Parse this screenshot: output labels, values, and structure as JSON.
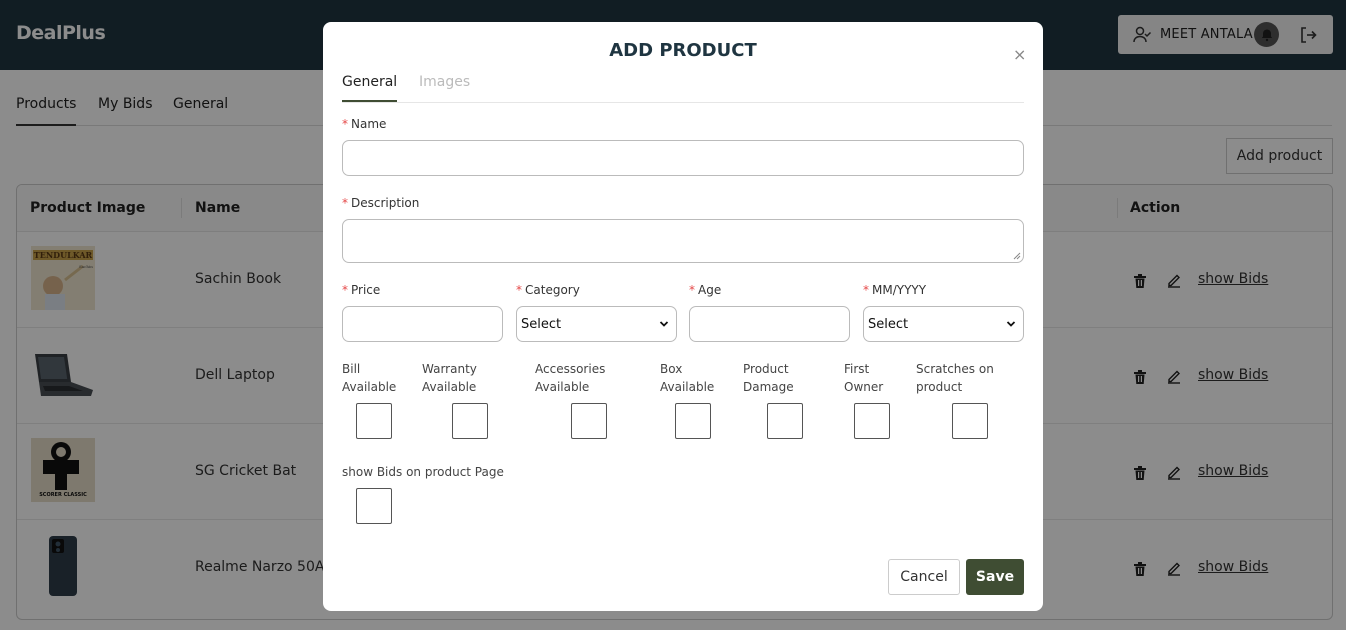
{
  "app": {
    "brand": "DealPlus"
  },
  "user": {
    "name": "MEET ANTALA"
  },
  "tabs": [
    {
      "label": "Products",
      "active": true
    },
    {
      "label": "My Bids",
      "active": false
    },
    {
      "label": "General",
      "active": false
    }
  ],
  "toolbar": {
    "add_product_label": "Add product"
  },
  "table": {
    "headers": [
      "Product Image",
      "Name",
      "Action"
    ],
    "rows": [
      {
        "name": "Sachin Book",
        "bids_label": "show Bids"
      },
      {
        "name": "Dell Laptop",
        "bids_label": "show Bids"
      },
      {
        "name": "SG Cricket Bat",
        "bids_label": "show Bids"
      },
      {
        "name": "Realme Narzo 50A",
        "bids_label": "show Bids"
      }
    ]
  },
  "modal": {
    "title": "ADD PRODUCT",
    "close": "×",
    "tabs": [
      {
        "label": "General",
        "active": true
      },
      {
        "label": "Images",
        "active": false
      }
    ],
    "fields": {
      "required_mark": "*",
      "name": {
        "label": "Name",
        "value": ""
      },
      "description": {
        "label": "Description",
        "value": ""
      },
      "price": {
        "label": "Price",
        "value": ""
      },
      "category": {
        "label": "Category",
        "selected": "Select"
      },
      "age": {
        "label": "Age",
        "value": ""
      },
      "month_year": {
        "label": "MM/YYYY",
        "selected": "Select"
      }
    },
    "checkboxes": [
      {
        "label_line1": "Bill",
        "label_line2": "Available",
        "checked": false
      },
      {
        "label_line1": "Warranty",
        "label_line2": "Available",
        "checked": false
      },
      {
        "label_line1": "Accessories",
        "label_line2": "Available",
        "checked": false
      },
      {
        "label_line1": "Box",
        "label_line2": "Available",
        "checked": false
      },
      {
        "label_line1": "Product",
        "label_line2": "Damage",
        "checked": false
      },
      {
        "label_line1": "First",
        "label_line2": "Owner",
        "checked": false
      },
      {
        "label_line1": "Scratches on",
        "label_line2": "product",
        "checked": false
      }
    ],
    "show_bids_checkbox": {
      "label": "show Bids on product Page",
      "checked": false
    },
    "buttons": {
      "cancel": "Cancel",
      "save": "Save"
    }
  },
  "colors": {
    "header_bg": "#1f3541",
    "accent": "#3f4d33",
    "required": "#e54848"
  }
}
